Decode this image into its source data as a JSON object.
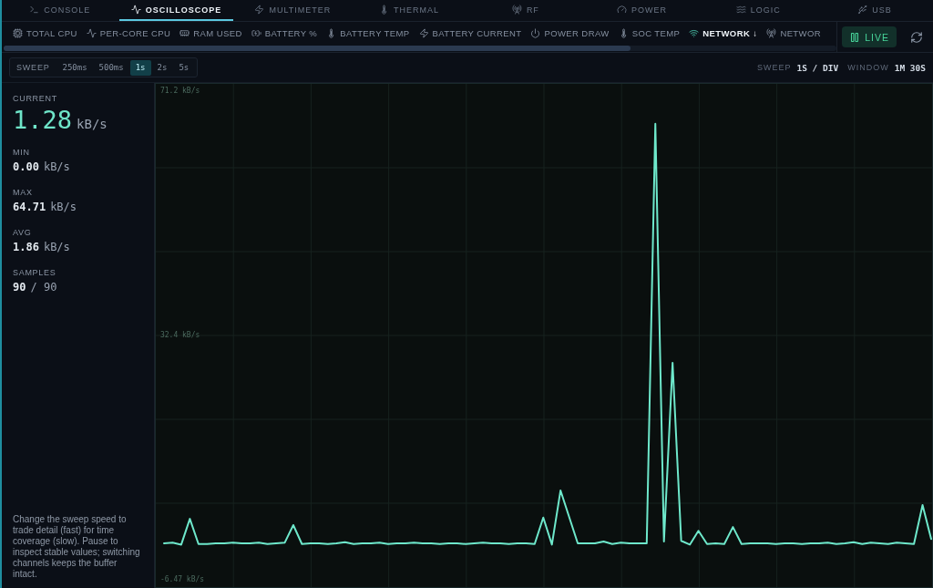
{
  "tabs": [
    {
      "label": "CONSOLE",
      "selected": false
    },
    {
      "label": "OSCILLOSCOPE",
      "selected": true
    },
    {
      "label": "MULTIMETER",
      "selected": false
    },
    {
      "label": "THERMAL",
      "selected": false
    },
    {
      "label": "RF",
      "selected": false
    },
    {
      "label": "POWER",
      "selected": false
    },
    {
      "label": "LOGIC",
      "selected": false
    },
    {
      "label": "USB",
      "selected": false
    }
  ],
  "channels": [
    {
      "label": "TOTAL CPU",
      "selected": false
    },
    {
      "label": "PER-CORE CPU",
      "selected": false
    },
    {
      "label": "RAM USED",
      "selected": false
    },
    {
      "label": "BATTERY %",
      "selected": false
    },
    {
      "label": "BATTERY TEMP",
      "selected": false
    },
    {
      "label": "BATTERY CURRENT",
      "selected": false
    },
    {
      "label": "POWER DRAW",
      "selected": false
    },
    {
      "label": "SOC TEMP",
      "selected": false
    },
    {
      "label": "NETWORK ↓",
      "selected": true
    },
    {
      "label": "NETWOR",
      "selected": false
    }
  ],
  "live_button": {
    "label": "LIVE"
  },
  "sweep": {
    "label": "SWEEP",
    "options": [
      {
        "label": "250ms",
        "selected": false
      },
      {
        "label": "500ms",
        "selected": false
      },
      {
        "label": "1s",
        "selected": true
      },
      {
        "label": "2s",
        "selected": false
      },
      {
        "label": "5s",
        "selected": false
      }
    ]
  },
  "readouts": [
    {
      "label": "SWEEP",
      "value": "1S / DIV"
    },
    {
      "label": "WINDOW",
      "value": "1M 30S"
    }
  ],
  "stats": [
    {
      "kind": "primary",
      "label": "CURRENT",
      "value": "1.28",
      "unit": "kB/s"
    },
    {
      "kind": "secondary",
      "label": "MIN",
      "value": "0.00",
      "unit": "kB/s"
    },
    {
      "kind": "secondary",
      "label": "MAX",
      "value": "64.71",
      "unit": "kB/s"
    },
    {
      "kind": "secondary",
      "label": "AVG",
      "value": "1.86",
      "unit": "kB/s"
    },
    {
      "kind": "secondary",
      "label": "SAMPLES",
      "value": "90",
      "unit": "/ 90"
    }
  ],
  "note": "Change the sweep speed to trade detail (fast) for time coverage (slow). Pause to inspect stable values; switching channels keeps the buffer intact.",
  "chart": {
    "chart_data": {
      "type": "line",
      "grid": true,
      "ylim": [
        -7.65,
        72.33
      ],
      "yticks": [
        {
          "value": 71.2,
          "label": "71.2 kB/s"
        },
        {
          "value": 32.4,
          "label": "32.4 kB/s"
        },
        {
          "value": -6.47,
          "label": "-6.47 kB/s"
        }
      ],
      "series": [
        {
          "color": "#6ee8cb",
          "values": [
            -0.7,
            -0.6,
            -0.9,
            3.2,
            -0.8,
            -0.8,
            -0.7,
            -0.7,
            -0.6,
            -0.7,
            -0.7,
            -0.6,
            -0.8,
            -0.7,
            -0.6,
            2.2,
            -0.8,
            -0.7,
            -0.7,
            -0.8,
            -0.7,
            -0.5,
            -0.8,
            -0.7,
            -0.7,
            -0.6,
            -0.8,
            -0.7,
            -0.7,
            -0.6,
            -0.7,
            -0.7,
            -0.8,
            -0.7,
            -0.7,
            -0.8,
            -0.7,
            -0.6,
            -0.7,
            -0.7,
            -0.8,
            -0.7,
            -0.7,
            -0.8,
            3.4,
            -0.9,
            7.7,
            3.5,
            -0.7,
            -0.7,
            -0.7,
            -0.4,
            -0.8,
            -0.6,
            -0.7,
            -0.7,
            -0.7,
            66,
            -0.4,
            28,
            -0.3,
            -0.9,
            1.3,
            -0.8,
            -0.7,
            -0.8,
            1.9,
            -0.8,
            -0.7,
            -0.7,
            -0.7,
            -0.8,
            -0.7,
            -0.7,
            -0.8,
            -0.7,
            -0.7,
            -0.6,
            -0.8,
            -0.7,
            -0.5,
            -0.8,
            -0.6,
            -0.7,
            -0.8,
            -0.6,
            -0.7,
            -0.8,
            5.4,
            0.0
          ]
        }
      ]
    }
  }
}
